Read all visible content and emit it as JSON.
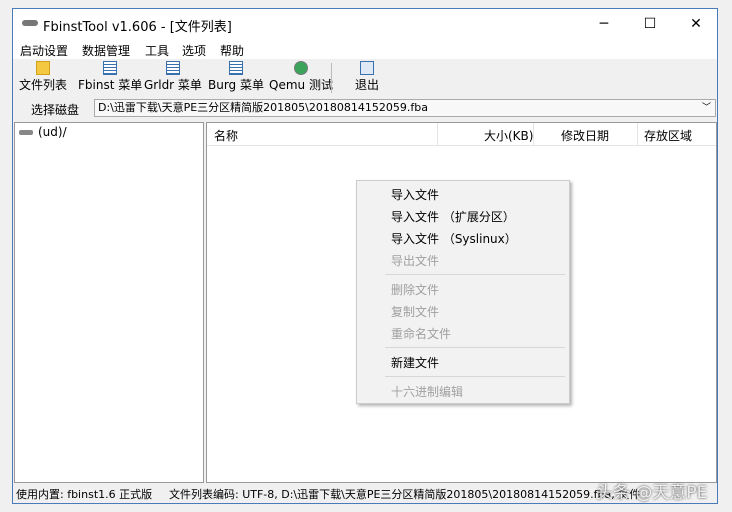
{
  "window": {
    "title": "FbinstTool v1.606 - [文件列表]",
    "minimize": "─",
    "maximize": "☐",
    "close": "✕"
  },
  "menu": [
    "启动设置",
    "数据管理",
    "工具",
    "选项",
    "帮助"
  ],
  "toolbar": [
    "文件列表",
    "Fbinst 菜单",
    "Grldr 菜单",
    "Burg 菜单",
    "Qemu 测试",
    "退出"
  ],
  "disk": {
    "label": "选择磁盘",
    "value": "D:\\迅雷下载\\天意PE三分区精简版201805\\20180814152059.fba"
  },
  "tree": {
    "root": "(ud)/"
  },
  "columns": [
    "名称",
    "大小(KB)",
    "修改日期",
    "存放区域"
  ],
  "context_menu": [
    {
      "label": "导入文件",
      "enabled": true
    },
    {
      "label": "导入文件 （扩展分区）",
      "enabled": true
    },
    {
      "label": "导入文件 （Syslinux）",
      "enabled": true
    },
    {
      "label": "导出文件",
      "enabled": false
    },
    {
      "label": "删除文件",
      "enabled": false
    },
    {
      "label": "复制文件",
      "enabled": false
    },
    {
      "label": "重命名文件",
      "enabled": false
    },
    {
      "label": "新建文件",
      "enabled": true
    },
    {
      "label": "十六进制编辑",
      "enabled": false
    }
  ],
  "status": {
    "left": "使用内置: fbinst1.6 正式版",
    "right": "文件列表编码: UTF-8, D:\\迅雷下载\\天意PE三分区精简版201805\\20180814152059.fba, 文件"
  },
  "watermark": "头条 @天意PE"
}
